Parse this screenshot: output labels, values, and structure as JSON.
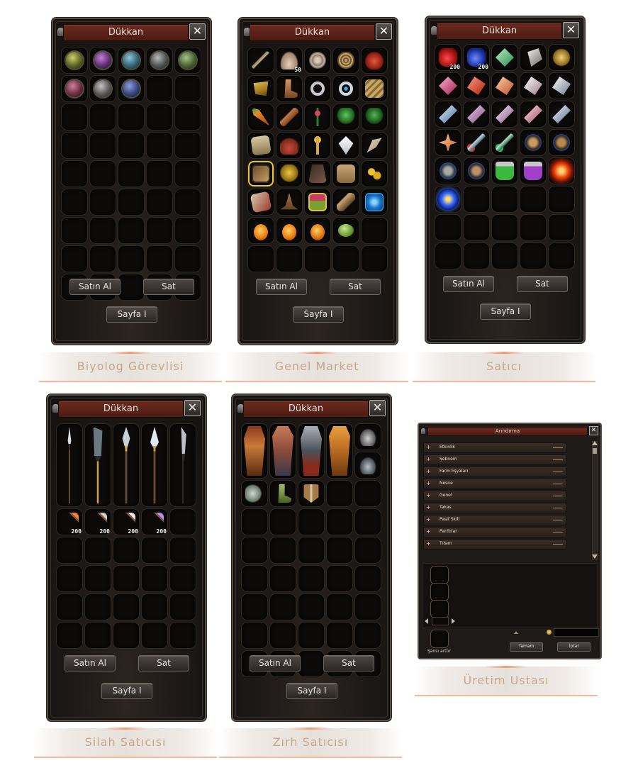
{
  "shops": [
    {
      "title": "Dükkan",
      "buy": "Satın Al",
      "sell": "Sat",
      "page": "Sayfa I",
      "caption": "Biyolog Görevlisi"
    },
    {
      "title": "Dükkan",
      "buy": "Satın Al",
      "sell": "Sat",
      "page": "Sayfa I",
      "caption": "Genel Market"
    },
    {
      "title": "Dükkan",
      "buy": "Satın Al",
      "sell": "Sat",
      "page": "Sayfa I",
      "caption": "Satıcı"
    },
    {
      "title": "Dükkan",
      "buy": "Satın Al",
      "sell": "Sat",
      "page": "Sayfa I",
      "caption": "Silah Satıcısı"
    },
    {
      "title": "Dükkan",
      "buy": "Satın Al",
      "sell": "Sat",
      "page": "Sayfa I",
      "caption": "Zırh Satıcısı"
    }
  ],
  "quantities": {
    "general_shells": "50",
    "seller_potion_red": "200",
    "seller_potion_blue": "200",
    "arrow1": "200",
    "arrow2": "200",
    "arrow3": "200",
    "arrow4": "200"
  },
  "crafting": {
    "title": "Arındırma",
    "categories": [
      "Etkinlik",
      "Şebnem",
      "Farm Eşyaları",
      "Nesne",
      "Genel",
      "Takas",
      "Pasif Skill",
      "Parıltılar",
      "Tılsım"
    ],
    "chance_label": "Şansı arttır",
    "ok": "Tamam",
    "cancel": "İptal",
    "caption": "Üretim Ustası"
  },
  "close_icon": "✕",
  "plus_icon": "+"
}
